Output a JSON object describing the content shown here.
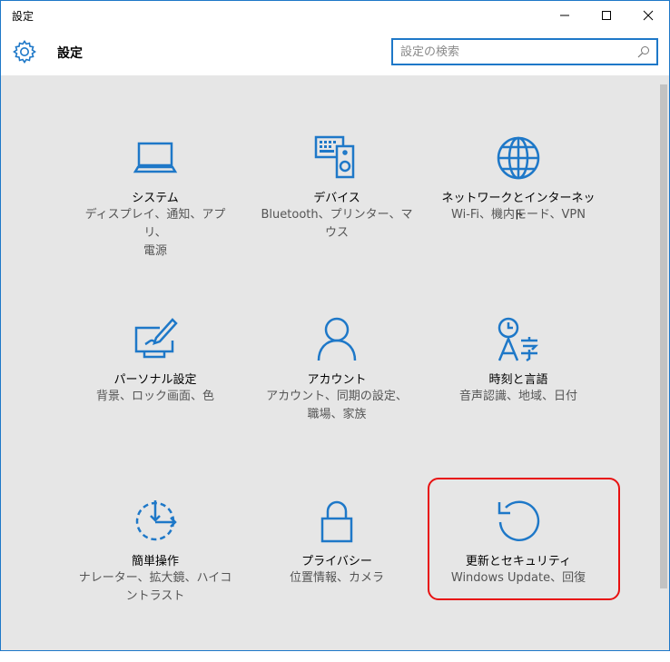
{
  "window": {
    "title": "設定",
    "accent": "#1e78c8"
  },
  "header": {
    "title": "設定",
    "search_placeholder": "設定の検索"
  },
  "tiles": [
    {
      "name": "システム",
      "desc_lines": [
        "ディスプレイ、通知、アプリ、",
        "電源"
      ],
      "icon": "laptop-icon"
    },
    {
      "name": "デバイス",
      "desc_lines": [
        "Bluetooth、プリンター、マ",
        "ウス"
      ],
      "icon": "devices-icon"
    },
    {
      "name": "ネットワークとインターネット",
      "desc_lines": [
        "Wi-Fi、機内モード、VPN"
      ],
      "icon": "globe-icon"
    },
    {
      "name": "パーソナル設定",
      "desc_lines": [
        "背景、ロック画面、色"
      ],
      "icon": "personalize-icon"
    },
    {
      "name": "アカウント",
      "desc_lines": [
        "アカウント、同期の設定、",
        "職場、家族"
      ],
      "icon": "person-icon"
    },
    {
      "name": "時刻と言語",
      "desc_lines": [
        "音声認識、地域、日付"
      ],
      "icon": "time-language-icon"
    },
    {
      "name": "簡単操作",
      "desc_lines": [
        "ナレーター、拡大鏡、ハイコ",
        "ントラスト"
      ],
      "icon": "ease-of-access-icon"
    },
    {
      "name": "プライバシー",
      "desc_lines": [
        "位置情報、カメラ"
      ],
      "icon": "lock-icon"
    },
    {
      "name": "更新とセキュリティ",
      "desc_lines": [
        "Windows Update、回復"
      ],
      "icon": "update-icon"
    }
  ],
  "highlight_color": "#e81010"
}
